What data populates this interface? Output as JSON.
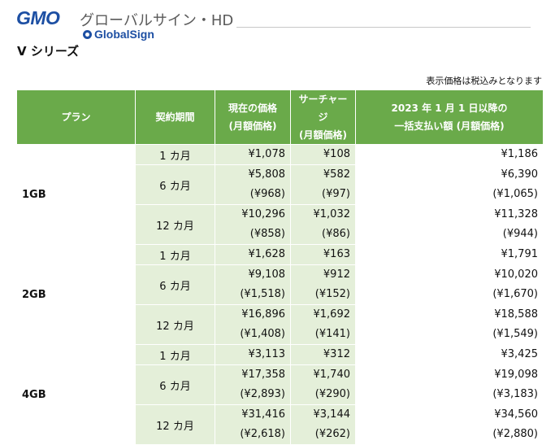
{
  "header": {
    "logo_gmo": "GMO",
    "company_name": "グローバルサイン・HD",
    "logo_globalsign": "GlobalSign"
  },
  "page_title": "V シリーズ",
  "tax_note": "表示価格は税込みとなります",
  "table": {
    "columns": [
      {
        "line1": "プラン",
        "line2": ""
      },
      {
        "line1": "契約期間",
        "line2": ""
      },
      {
        "line1": "現在の価格",
        "line2": "(月額価格)"
      },
      {
        "line1": "サーチャージ",
        "line2": "(月額価格)"
      },
      {
        "line1": "2023 年 1 月 1 日以降の",
        "line2": "一括支払い額 (月額価格)"
      }
    ],
    "plans": [
      {
        "name": "1GB",
        "rows": [
          {
            "term": "1 カ月",
            "current": [
              "¥1,078"
            ],
            "surcharge": [
              "¥108"
            ],
            "total": [
              "¥1,186"
            ]
          },
          {
            "term": "6 カ月",
            "current": [
              "¥5,808",
              "(¥968)"
            ],
            "surcharge": [
              "¥582",
              "(¥97)"
            ],
            "total": [
              "¥6,390",
              "(¥1,065)"
            ]
          },
          {
            "term": "12 カ月",
            "current": [
              "¥10,296",
              "(¥858)"
            ],
            "surcharge": [
              "¥1,032",
              "(¥86)"
            ],
            "total": [
              "¥11,328",
              "(¥944)"
            ]
          }
        ]
      },
      {
        "name": "2GB",
        "rows": [
          {
            "term": "1 カ月",
            "current": [
              "¥1,628"
            ],
            "surcharge": [
              "¥163"
            ],
            "total": [
              "¥1,791"
            ]
          },
          {
            "term": "6 カ月",
            "current": [
              "¥9,108",
              "(¥1,518)"
            ],
            "surcharge": [
              "¥912",
              "(¥152)"
            ],
            "total": [
              "¥10,020",
              "(¥1,670)"
            ]
          },
          {
            "term": "12 カ月",
            "current": [
              "¥16,896",
              "(¥1,408)"
            ],
            "surcharge": [
              "¥1,692",
              "(¥141)"
            ],
            "total": [
              "¥18,588",
              "(¥1,549)"
            ]
          }
        ]
      },
      {
        "name": "4GB",
        "rows": [
          {
            "term": "1 カ月",
            "current": [
              "¥3,113"
            ],
            "surcharge": [
              "¥312"
            ],
            "total": [
              "¥3,425"
            ]
          },
          {
            "term": "6 カ月",
            "current": [
              "¥17,358",
              "(¥2,893)"
            ],
            "surcharge": [
              "¥1,740",
              "(¥290)"
            ],
            "total": [
              "¥19,098",
              "(¥3,183)"
            ]
          },
          {
            "term": "12 カ月",
            "current": [
              "¥31,416",
              "(¥2,618)"
            ],
            "surcharge": [
              "¥3,144",
              "(¥262)"
            ],
            "total": [
              "¥34,560",
              "(¥2,880)"
            ]
          }
        ]
      }
    ]
  }
}
